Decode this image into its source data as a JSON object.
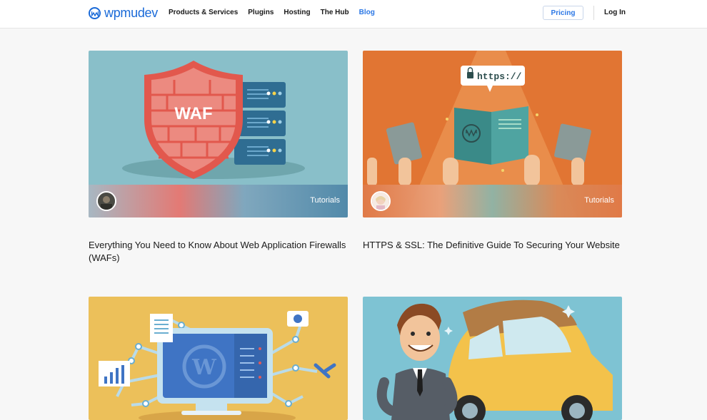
{
  "brand": {
    "name": "wpmudev",
    "color": "#1a6ad8"
  },
  "nav": {
    "items": [
      {
        "label": "Products & Services"
      },
      {
        "label": "Plugins"
      },
      {
        "label": "Hosting"
      },
      {
        "label": "The Hub"
      },
      {
        "label": "Blog",
        "active": true
      }
    ],
    "pricing_label": "Pricing",
    "login_label": "Log In"
  },
  "posts": [
    {
      "title": "Everything You Need to Know About Web Application Firewalls (WAFs)",
      "category": "Tutorials",
      "badge_text": "WAF",
      "bg_color": "#89bfc9"
    },
    {
      "title": "HTTPS & SSL: The Definitive Guide To Securing Your Website",
      "category": "Tutorials",
      "badge_text": "https://",
      "bg_color": "#e17533"
    },
    {
      "title": "",
      "category": "",
      "bg_color": "#ecc05a"
    },
    {
      "title": "",
      "category": "",
      "bg_color": "#7ec3d3"
    }
  ]
}
